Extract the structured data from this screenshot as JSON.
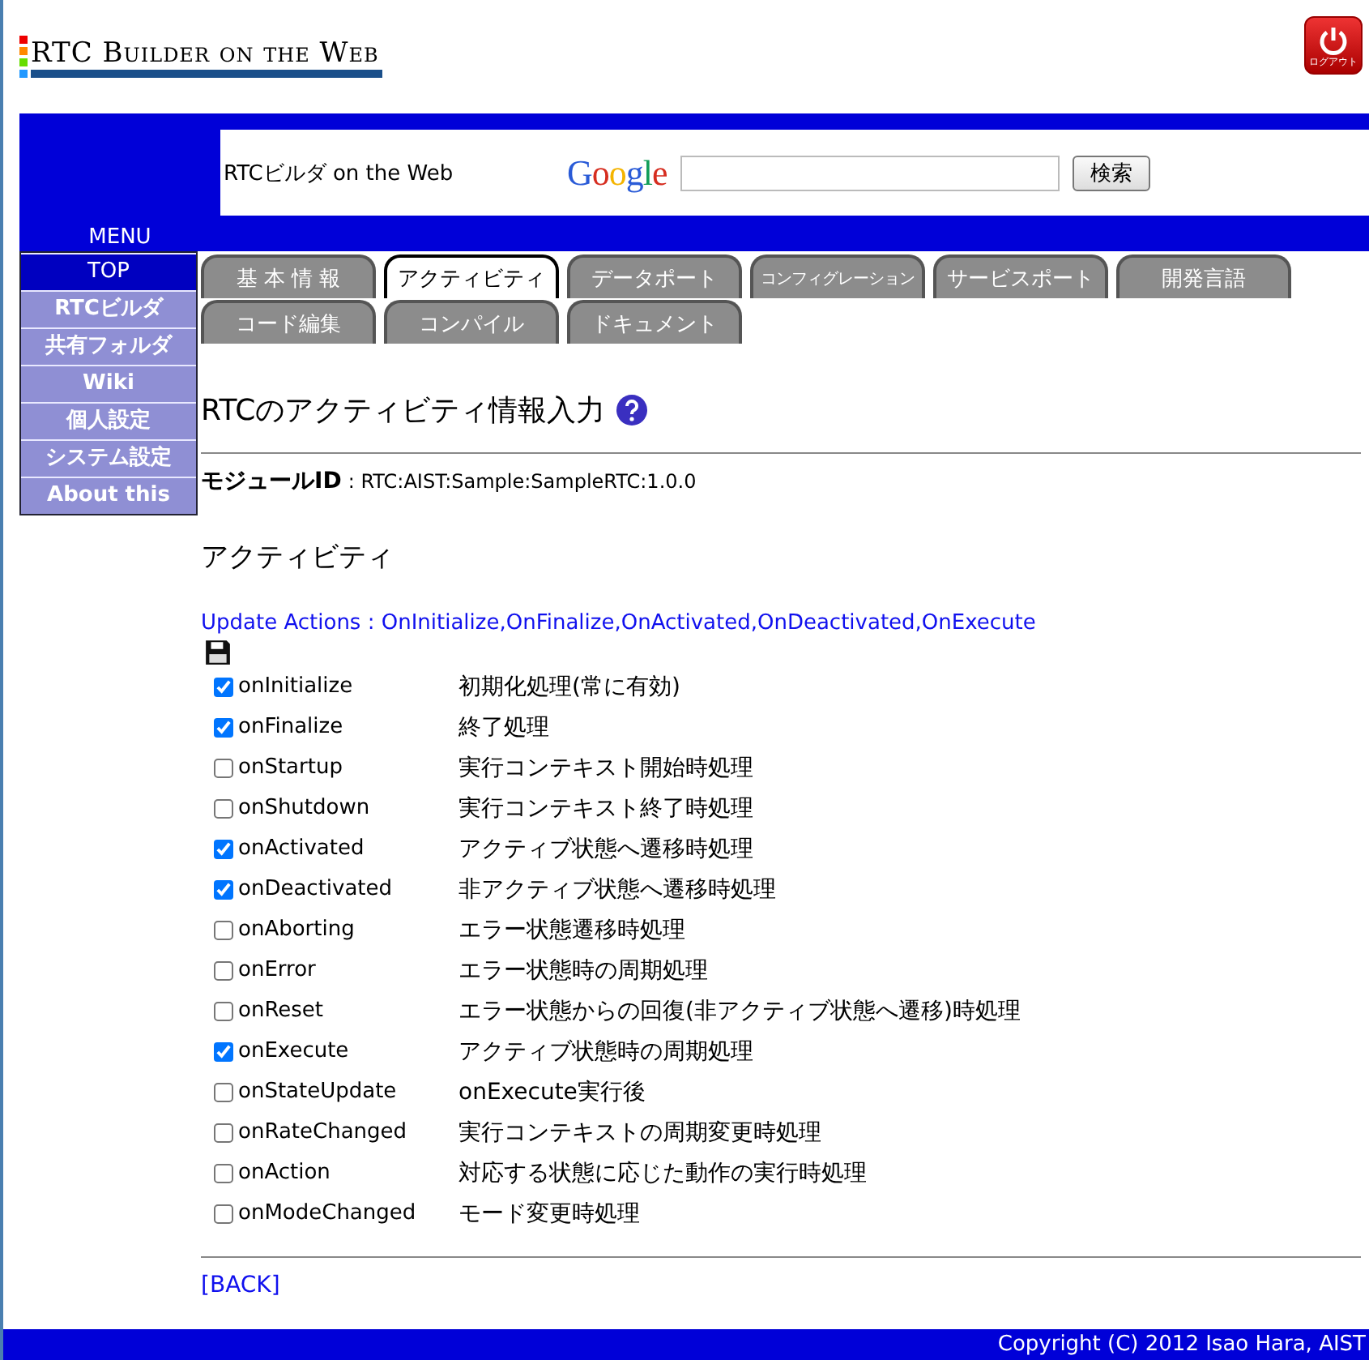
{
  "header": {
    "logo": "RTC Builder on the Web",
    "logout": "ログアウト"
  },
  "search_bar": {
    "site_title": "RTCビルダ on the Web",
    "google": "Google",
    "button": "検索"
  },
  "menu": {
    "title": "MENU",
    "items": [
      {
        "label": "TOP",
        "selected": true
      },
      {
        "label": "RTCビルダ",
        "selected": false
      },
      {
        "label": "共有フォルダ",
        "selected": false
      },
      {
        "label": "Wiki",
        "selected": false
      },
      {
        "label": "個人設定",
        "selected": false
      },
      {
        "label": "システム設定",
        "selected": false
      },
      {
        "label": "About this",
        "selected": false
      }
    ]
  },
  "tabs": [
    [
      {
        "label": "基 本 情 報",
        "selected": false,
        "small": false
      },
      {
        "label": "アクティビティ",
        "selected": true,
        "small": false
      },
      {
        "label": "データポート",
        "selected": false,
        "small": false
      },
      {
        "label": "コンフィグレーション",
        "selected": false,
        "small": true
      },
      {
        "label": "サービスポート",
        "selected": false,
        "small": false
      },
      {
        "label": "開発言語",
        "selected": false,
        "small": false
      }
    ],
    [
      {
        "label": "コード編集",
        "selected": false,
        "small": false
      },
      {
        "label": "コンパイル",
        "selected": false,
        "small": false
      },
      {
        "label": "ドキュメント",
        "selected": false,
        "small": false
      }
    ]
  ],
  "page_title": "RTCのアクティビティ情報入力",
  "module_id": {
    "label": "モジュールID",
    "value": ": RTC:AIST:Sample:SampleRTC:1.0.0"
  },
  "section_title": "アクティビティ",
  "update_actions": "Update Actions : OnInitialize,OnFinalize,OnActivated,OnDeactivated,OnExecute",
  "activities": [
    {
      "name": "onInitialize",
      "description": "初期化処理(常に有効)",
      "checked": true
    },
    {
      "name": "onFinalize",
      "description": "終了処理",
      "checked": true
    },
    {
      "name": "onStartup",
      "description": "実行コンテキスト開始時処理",
      "checked": false
    },
    {
      "name": "onShutdown",
      "description": "実行コンテキスト終了時処理",
      "checked": false
    },
    {
      "name": "onActivated",
      "description": "アクティブ状態へ遷移時処理",
      "checked": true
    },
    {
      "name": "onDeactivated",
      "description": "非アクティブ状態へ遷移時処理",
      "checked": true
    },
    {
      "name": "onAborting",
      "description": "エラー状態遷移時処理",
      "checked": false
    },
    {
      "name": "onError",
      "description": "エラー状態時の周期処理",
      "checked": false
    },
    {
      "name": "onReset",
      "description": "エラー状態からの回復(非アクティブ状態へ遷移)時処理",
      "checked": false
    },
    {
      "name": "onExecute",
      "description": "アクティブ状態時の周期処理",
      "checked": true
    },
    {
      "name": "onStateUpdate",
      "description": "onExecute実行後",
      "checked": false
    },
    {
      "name": "onRateChanged",
      "description": "実行コンテキストの周期変更時処理",
      "checked": false
    },
    {
      "name": "onAction",
      "description": "対応する状態に応じた動作の実行時処理",
      "checked": false
    },
    {
      "name": "onModeChanged",
      "description": "モード変更時処理",
      "checked": false
    }
  ],
  "back_link": "[BACK]",
  "footer": "Copyright (C) 2012 Isao Hara, AIST"
}
